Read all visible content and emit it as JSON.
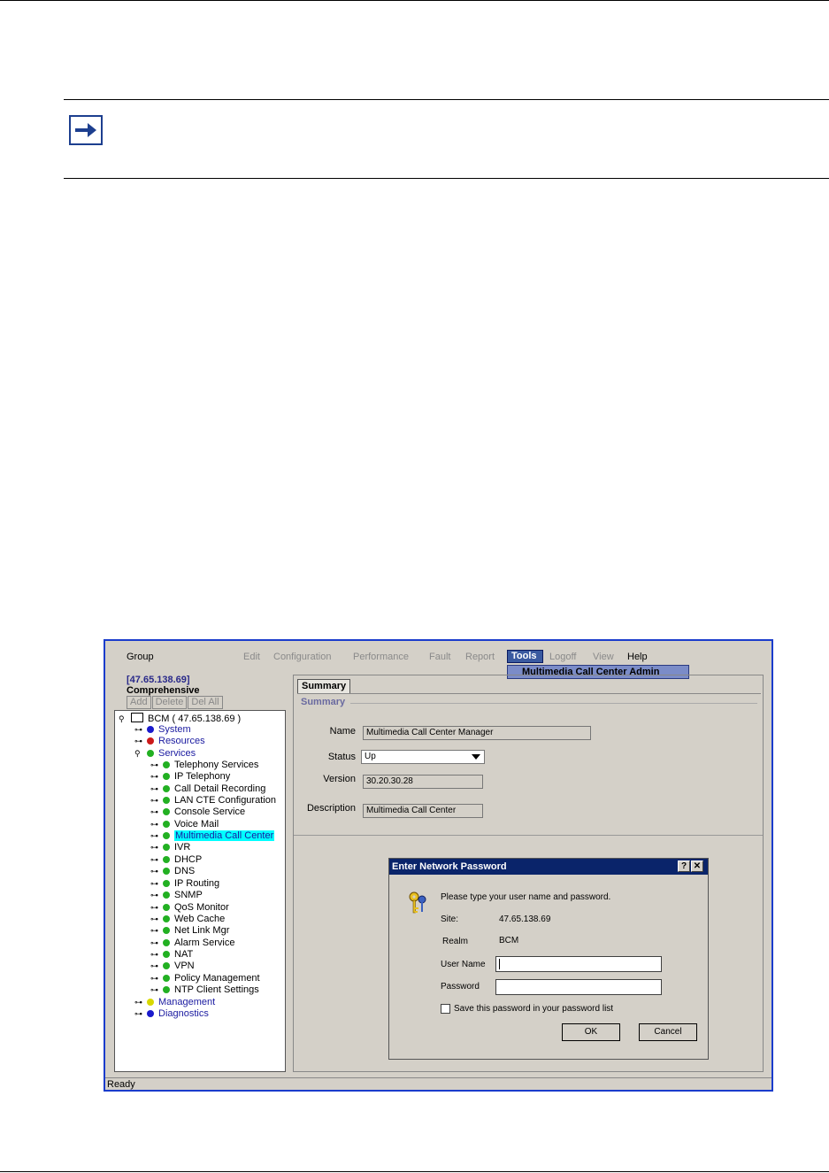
{
  "window": {
    "menu": {
      "group": "Group",
      "items": [
        "Edit",
        "Configuration",
        "Performance",
        "Fault",
        "Report",
        "Tools",
        "Logoff",
        "View",
        "Help"
      ],
      "tools_dropdown_item": "Multimedia Call Center Admin"
    },
    "left_panel": {
      "ip": "[47.65.138.69]",
      "view": "Comprehensive",
      "buttons": [
        "Add",
        "Delete",
        "Del All"
      ],
      "tree": {
        "root": "BCM ( 47.65.138.69 )",
        "top_level": [
          "System",
          "Resources",
          "Services",
          "Management",
          "Diagnostics"
        ],
        "services": [
          "Telephony Services",
          "IP Telephony",
          "Call Detail Recording",
          "LAN CTE Configuration",
          "Console Service",
          "Voice Mail",
          "Multimedia Call Center",
          "IVR",
          "DHCP",
          "DNS",
          "IP Routing",
          "SNMP",
          "QoS Monitor",
          "Web Cache",
          "Net Link Mgr",
          "Alarm Service",
          "NAT",
          "VPN",
          "Policy Management",
          "NTP Client Settings"
        ]
      }
    },
    "summary": {
      "tab_label": "Summary",
      "section_title": "Summary",
      "name_label": "Name",
      "name_value": "Multimedia Call Center Manager",
      "status_label": "Status",
      "status_value": "Up",
      "version_label": "Version",
      "version_value": "30.20.30.28",
      "description_label": "Description",
      "description_value": "Multimedia Call Center"
    },
    "dialog": {
      "title": "Enter Network Password",
      "help_btn": "?",
      "close_btn": "✕",
      "prompt": "Please type your user name and password.",
      "site_label": "Site:",
      "site_value": "47.65.138.69",
      "realm_label": "Realm",
      "realm_value": "BCM",
      "username_label": "User Name",
      "username_value": "",
      "password_label": "Password",
      "password_value": "",
      "save_label": "Save this password in your password list",
      "ok": "OK",
      "cancel": "Cancel"
    },
    "status_bar": "Ready"
  },
  "colors": {
    "window_border": "#1a3ccc",
    "title_bar": "#0a246a",
    "selection": "#00ffff",
    "green": "#22b022",
    "blue": "#1a1acc",
    "red": "#cc1a1a",
    "yellow": "#d8d800"
  }
}
